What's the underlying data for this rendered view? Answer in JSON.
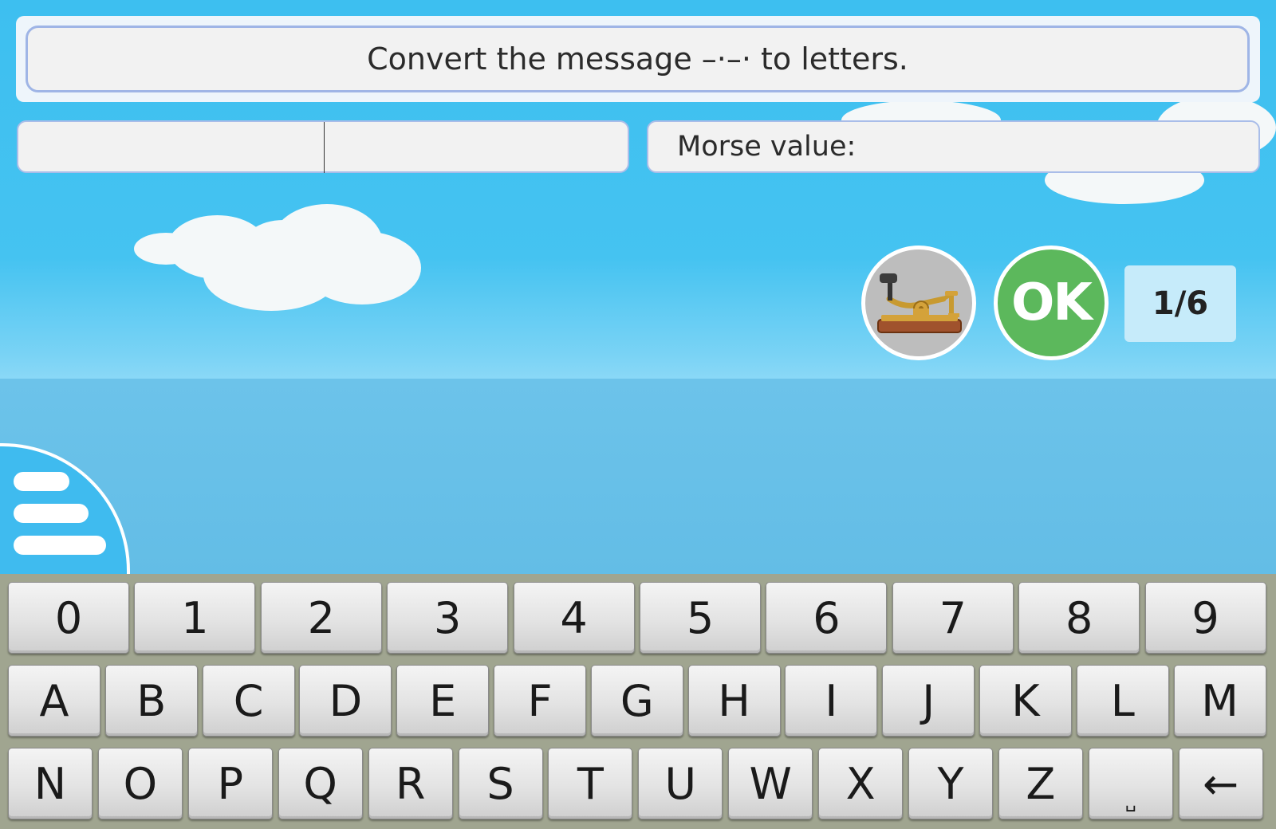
{
  "question": {
    "text": "Convert the message –·–· to letters."
  },
  "answer": {
    "value": ""
  },
  "morse": {
    "label": "Morse value:"
  },
  "buttons": {
    "ok_label": "OK",
    "telegraph_icon": "telegraph-key-icon",
    "menu_icon": "hamburger-menu-icon"
  },
  "progress": {
    "text": "1/6"
  },
  "keyboard": {
    "row1": [
      "0",
      "1",
      "2",
      "3",
      "4",
      "5",
      "6",
      "7",
      "8",
      "9"
    ],
    "row2": [
      "A",
      "B",
      "C",
      "D",
      "E",
      "F",
      "G",
      "H",
      "I",
      "J",
      "K",
      "L",
      "M"
    ],
    "row3": [
      "N",
      "O",
      "P",
      "Q",
      "R",
      "S",
      "T",
      "U",
      "W",
      "X",
      "Y",
      "Z",
      "␣",
      "←"
    ]
  },
  "colors": {
    "sky": "#40c0f0",
    "ok_green": "#5cb85c",
    "counter_bg": "#c6ebfa",
    "keyboard_bg": "#a0a590"
  }
}
